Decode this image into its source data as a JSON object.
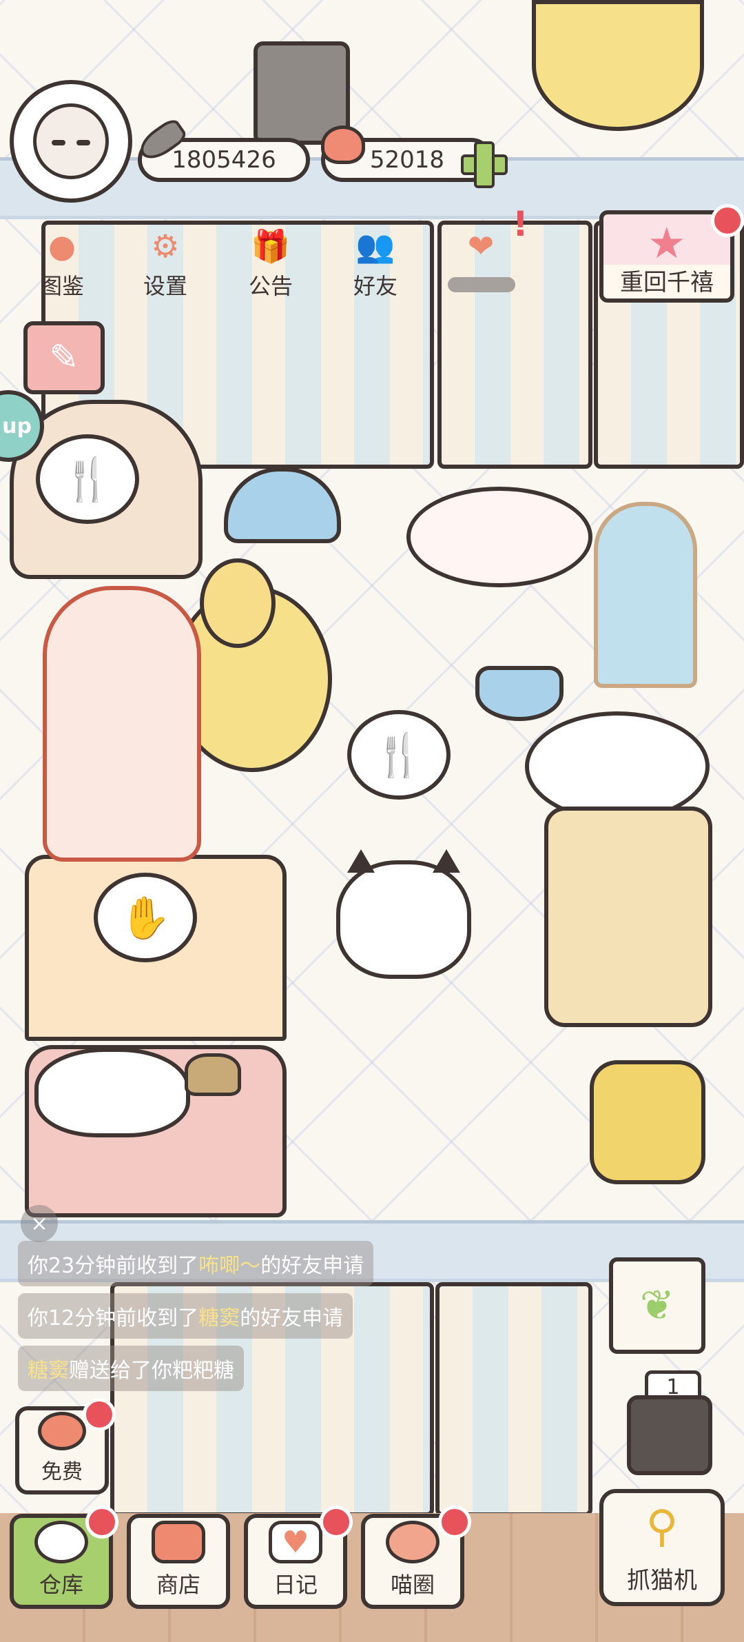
{
  "top": {
    "fish_coins": "1805426",
    "hearts": "52018"
  },
  "menu": [
    {
      "label": "图鉴"
    },
    {
      "label": "设置"
    },
    {
      "label": "公告"
    },
    {
      "label": "好友"
    }
  ],
  "event_banner": {
    "label": "重回千禧"
  },
  "side_tab": {
    "label": "up"
  },
  "chat": {
    "line1": {
      "pre": "你23分钟前收到了",
      "name": "咘唧～",
      "post": "的好友申请"
    },
    "line2": {
      "pre": "你12分钟前收到了",
      "name": "糖窦",
      "post": "的好友申请"
    },
    "line3": {
      "name": "糖窦",
      "post": "赠送给了你粑粑糖"
    }
  },
  "free_button": {
    "label": "免费"
  },
  "bottom_nav": {
    "warehouse": "仓库",
    "shop": "商店",
    "diary": "日记",
    "circle": "喵圈"
  },
  "claw_machine": {
    "label": "抓猫机"
  },
  "counter": "1",
  "colors": {
    "accent_green": "#a8cf6e",
    "badge_red": "#e8525a",
    "outline": "#3e3533",
    "orange": "#ee8a6f"
  }
}
